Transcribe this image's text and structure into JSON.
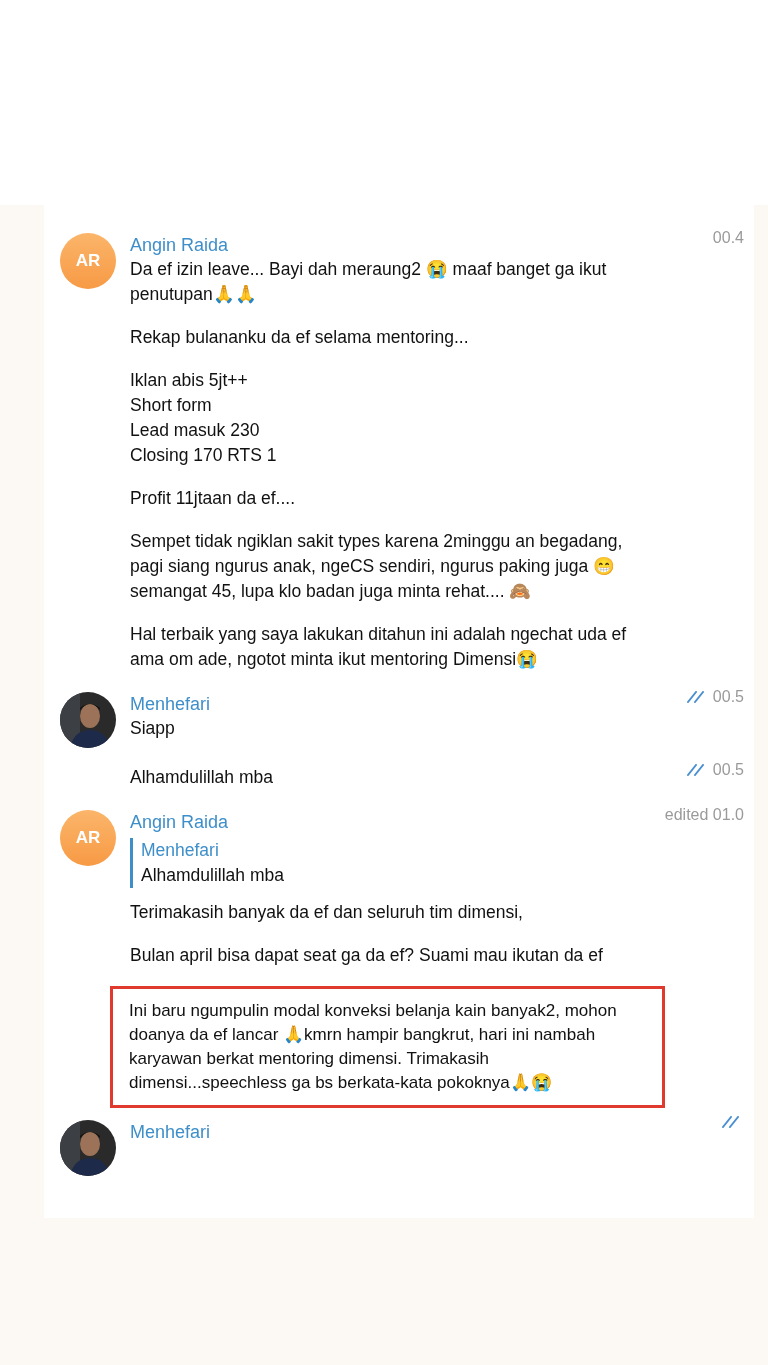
{
  "messages": [
    {
      "kind": "first",
      "author": "Angin Raida",
      "avatar": {
        "kind": "initials",
        "text": "AR"
      },
      "time": "00.4",
      "read": false,
      "paragraphs": [
        {
          "text": "Da ef izin leave... Bayi dah meraung2 😭 maaf banget ga ikut penutupan🙏🙏",
          "boxed": false
        },
        {
          "text": "Rekap bulananku da ef selama mentoring...",
          "boxed": false
        },
        {
          "text": "Iklan abis 5jt++\nShort form\nLead masuk 230\nClosing 170 RTS 1",
          "boxed": false
        },
        {
          "text": "Profit 11jtaan da ef....",
          "boxed": false
        },
        {
          "text": "Sempet tidak ngiklan sakit types karena 2minggu an begadang, pagi siang ngurus anak, ngeCS sendiri, ngurus paking juga 😁 semangat 45, lupa klo badan juga minta rehat.... 🙈",
          "boxed": false
        },
        {
          "text": "Hal terbaik yang saya lakukan ditahun ini adalah ngechat uda ef ama om ade, ngotot minta ikut mentoring Dimensi😭",
          "boxed": false
        }
      ]
    },
    {
      "kind": "first",
      "author": "Menhefari",
      "time": "00.5",
      "read": true,
      "paragraphs": [
        {
          "text": "Siapp",
          "boxed": false
        }
      ]
    },
    {
      "kind": "followup",
      "time": "00.5",
      "read": true,
      "paragraphs": [
        {
          "text": "Alhamdulillah mba",
          "boxed": false
        }
      ]
    },
    {
      "kind": "first",
      "author": "Angin Raida",
      "avatar": {
        "kind": "initials",
        "text": "AR"
      },
      "time": "edited 01.0",
      "read": false,
      "reply": {
        "author": "Menhefari",
        "text": "Alhamdulillah mba"
      },
      "paragraphs": [
        {
          "text": "Terimakasih banyak da ef dan seluruh tim dimensi,",
          "boxed": false
        },
        {
          "text": "Bulan april bisa dapat seat ga da ef? Suami mau ikutan da ef",
          "boxed": false
        },
        {
          "text": "Ini baru ngumpulin modal konveksi belanja kain banyak2, mohon doanya da ef lancar 🙏kmrn hampir bangkrut, hari ini nambah karyawan berkat mentoring dimensi. Trimakasih dimensi...speechless ga bs berkata-kata pokoknya🙏😭",
          "boxed": true
        }
      ]
    },
    {
      "kind": "first",
      "author": "Menhefari",
      "read": true
    }
  ]
}
